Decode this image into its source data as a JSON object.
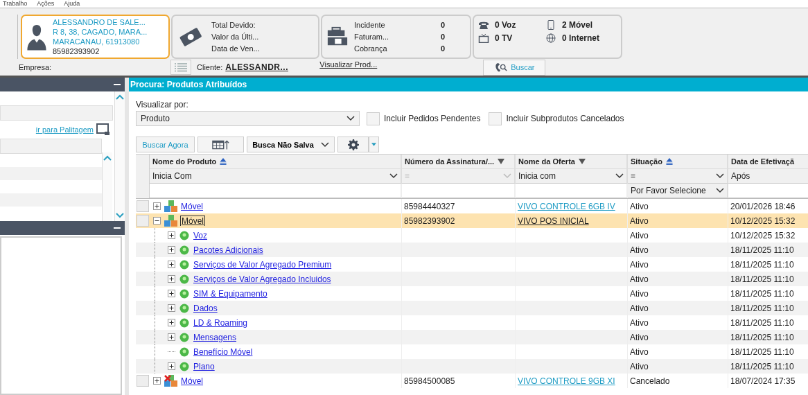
{
  "menu": [
    {
      "label": "Trabalho"
    },
    {
      "label": "Ações"
    },
    {
      "label": "Ajuda"
    }
  ],
  "customer": {
    "name": "ALESSANDRO DE SALE...",
    "address": "R 8, 38, CAGADO, MARA...",
    "city": "MARACANAU, 61913080",
    "phone": "85982393902",
    "selected": true
  },
  "billing": {
    "labels": [
      "Total Devido:",
      "Valor da Últi...",
      "Data de Ven..."
    ]
  },
  "counts": [
    {
      "label": "Incidente",
      "value": "0"
    },
    {
      "label": "Faturam...",
      "value": "0"
    },
    {
      "label": "Cobrança",
      "value": "0"
    }
  ],
  "services": [
    {
      "kind": "phone",
      "label": "0 Voz"
    },
    {
      "kind": "mobile",
      "label": "2 Móvel"
    },
    {
      "kind": "tv",
      "label": "0 TV"
    },
    {
      "kind": "internet",
      "label": "0 Internet"
    }
  ],
  "company_label": "Empresa:",
  "client": {
    "label": "Cliente:",
    "value": "ALESSANDR..."
  },
  "view_products_link": "Visualizar Prod...",
  "search_button": "Buscar",
  "left_panel": {
    "link": "ir para Palitagem"
  },
  "panel": {
    "title": "Procura: Produtos Atribuídos",
    "view_by_label": "Visualizar por:",
    "view_by": "Produto",
    "options": [
      {
        "label": "Incluir Pedidos Pendentes",
        "checked": false
      },
      {
        "label": "Incluir Subprodutos Cancelados",
        "checked": false
      }
    ]
  },
  "toolbar": {
    "search_now": "Buscar Agora",
    "saved_search": "Busca Não Salva"
  },
  "columns": [
    {
      "label": "Nome do Produto",
      "sorted_ascending": true,
      "has_menu": false,
      "filter": "Inicia Com",
      "filter_disabled": false
    },
    {
      "label": "Número da Assinatura/...",
      "sorted_ascending": false,
      "has_menu": true,
      "filter": "=",
      "filter_disabled": true
    },
    {
      "label": "Nome da Oferta",
      "sorted_ascending": false,
      "has_menu": true,
      "filter": "Inicia com",
      "filter_disabled": false
    },
    {
      "label": "Situação",
      "sorted_ascending": true,
      "has_menu": false,
      "filter": "=",
      "filter_disabled": false,
      "filter_value": "Por Favor Selecione"
    },
    {
      "label": "Data de Efetivaçã",
      "filter": "Após",
      "filter_disabled": false
    }
  ],
  "products": [
    {
      "name": "Móvel",
      "number": "85984440327",
      "offer": "VIVO CONTROLE 6GB IV",
      "status": "Ativo",
      "date": "20/01/2026 18:46",
      "expanded": false,
      "selected": false,
      "cancelled": false
    },
    {
      "name": "Móvel",
      "number": "85982393902",
      "offer": "VIVO POS INICIAL",
      "status": "Ativo",
      "date": "10/12/2025 15:32",
      "expanded": true,
      "selected": true,
      "cancelled": false,
      "children": [
        {
          "name": "Voz",
          "status": "Ativo",
          "date": "10/12/2025 15:32",
          "expandable": true
        },
        {
          "name": "Pacotes Adicionais",
          "status": "Ativo",
          "date": "18/11/2025 11:10",
          "expandable": true
        },
        {
          "name": "Serviços de Valor Agregado Premium",
          "status": "Ativo",
          "date": "18/11/2025 11:10",
          "expandable": true
        },
        {
          "name": "Serviços de Valor Agregado Incluidos",
          "status": "Ativo",
          "date": "18/11/2025 11:10",
          "expandable": true
        },
        {
          "name": "SIM & Equipamento",
          "status": "Ativo",
          "date": "18/11/2025 11:10",
          "expandable": true
        },
        {
          "name": "Dados",
          "status": "Ativo",
          "date": "18/11/2025 11:10",
          "expandable": true
        },
        {
          "name": "LD & Roaming",
          "status": "Ativo",
          "date": "18/11/2025 11:10",
          "expandable": true
        },
        {
          "name": "Mensagens",
          "status": "Ativo",
          "date": "18/11/2025 11:10",
          "expandable": true
        },
        {
          "name": "Benefício Móvel",
          "status": "Ativo",
          "date": "18/11/2025 11:10",
          "expandable": false
        },
        {
          "name": "Plano",
          "status": "Ativo",
          "date": "18/11/2025 11:10",
          "expandable": true
        }
      ]
    },
    {
      "name": "Móvel",
      "number": "85984500085",
      "offer": "VIVO CONTROLE 9GB XI",
      "status": "Cancelado",
      "date": "18/07/2024 17:35",
      "expanded": false,
      "selected": false,
      "cancelled": true
    }
  ]
}
